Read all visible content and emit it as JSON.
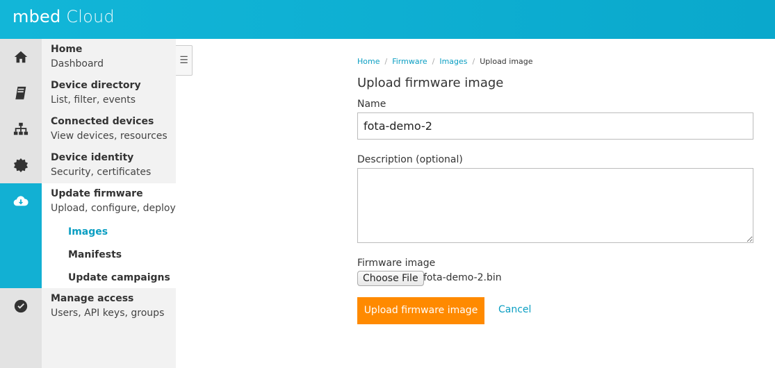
{
  "app": {
    "logo_part1": "mbed",
    "logo_part2": " Cloud"
  },
  "sidebar": {
    "items": [
      {
        "title": "Home",
        "subtitle": "Dashboard",
        "icon": "home-icon"
      },
      {
        "title": "Device directory",
        "subtitle": "List, filter, events",
        "icon": "book-icon"
      },
      {
        "title": "Connected devices",
        "subtitle": "View devices, resources",
        "icon": "sitemap-icon"
      },
      {
        "title": "Device identity",
        "subtitle": "Security, certificates",
        "icon": "certificate-icon"
      },
      {
        "title": "Update firmware",
        "subtitle": "Upload, configure, deploy",
        "icon": "cloud-download-icon"
      },
      {
        "title": "Manage access",
        "subtitle": "Users, API keys, groups",
        "icon": "check-circle-icon"
      }
    ],
    "subitems": [
      "Images",
      "Manifests",
      "Update campaigns"
    ],
    "toggle_icon": "menu-icon"
  },
  "breadcrumb": {
    "home": "Home",
    "firmware": "Firmware",
    "images": "Images",
    "current": "Upload image",
    "sep": "/"
  },
  "form": {
    "title": "Upload firmware image",
    "name_label": "Name",
    "name_value": "fota-demo-2",
    "description_label": "Description (optional)",
    "description_value": "",
    "file_label": "Firmware image",
    "choose_file": "Choose File",
    "file_name": "fota-demo-2.bin",
    "submit_label": "Upload firmware image",
    "cancel_label": "Cancel"
  },
  "colors": {
    "accent": "#12b0d3",
    "primary_button": "#ff8a00",
    "link": "#0a9ec2"
  }
}
